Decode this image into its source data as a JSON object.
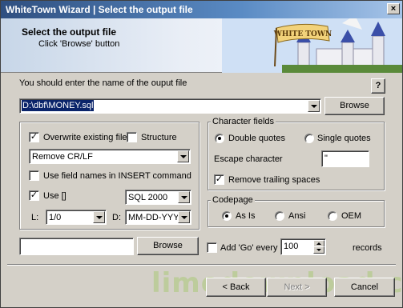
{
  "window": {
    "title": "WhiteTown Wizard | Select the output file",
    "close_glyph": "×"
  },
  "header": {
    "title": "Select the output file",
    "subtitle": "Click 'Browse' button",
    "banner_text": "WHITE TOWN"
  },
  "output": {
    "prompt": "You should enter the name of the ouput file",
    "help_label": "?",
    "file_value": "D:\\dbf\\MONEY.sql",
    "browse_label": "Browse"
  },
  "options": {
    "overwrite_label": "Overwrite existing file",
    "overwrite_checked": true,
    "structure_label": "Structure",
    "structure_checked": false,
    "crlf_value": "Remove CR/LF",
    "field_names_label": "Use field names in INSERT command",
    "field_names_checked": false,
    "use_brackets_label": "Use []",
    "use_brackets_checked": true,
    "sql_version_value": "SQL 2000",
    "l_label": "L:",
    "l_value": "1/0",
    "d_label": "D:",
    "d_value": "MM-DD-YYYY"
  },
  "character_fields": {
    "title": "Character fields",
    "double_quotes_label": "Double quotes",
    "single_quotes_label": "Single quotes",
    "selected": "Double quotes",
    "escape_label": "Escape character",
    "escape_value": "\"",
    "remove_trailing_label": "Remove trailing spaces",
    "remove_trailing_checked": true
  },
  "codepage": {
    "title": "Codepage",
    "options": [
      "As Is",
      "Ansi",
      "OEM"
    ],
    "selected": "As Is"
  },
  "extra": {
    "file_value": "",
    "browse_label": "Browse",
    "add_go_label": "Add 'Go' every",
    "add_go_checked": false,
    "records_value": "100",
    "records_label": "records"
  },
  "footer": {
    "back_label": "< Back",
    "next_label": "Next >",
    "cancel_label": "Cancel",
    "watermark": "limedownload.com"
  },
  "colors": {
    "title_start": "#2f4f80",
    "selection": "#0a246a",
    "face": "#d4d0c8"
  }
}
